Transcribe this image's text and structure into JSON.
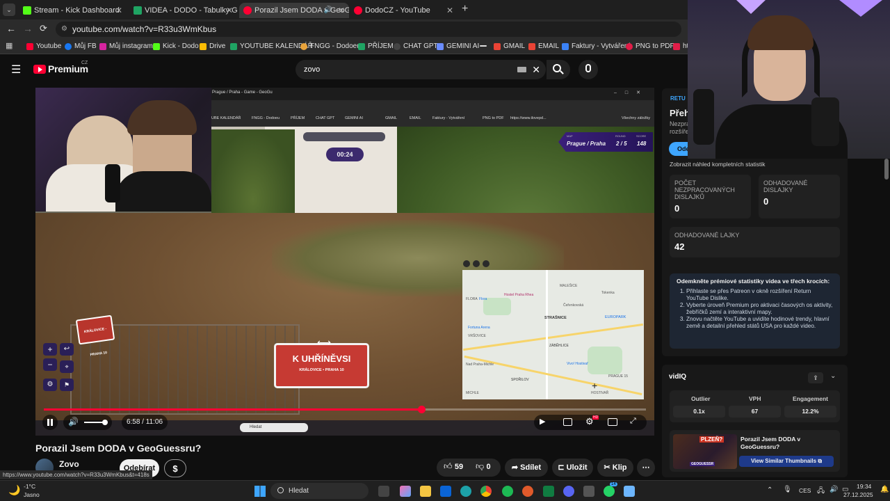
{
  "browser": {
    "tabs": [
      {
        "label": "Stream - Kick Dashboard",
        "color": "#53fc18"
      },
      {
        "label": "VIDEA - DODO - Tabulky Googl",
        "color": "#1fa463"
      },
      {
        "label": "Porazil Jsem DODA v GeoGu",
        "color": "#ff0033"
      },
      {
        "label": "DodoCZ - YouTube",
        "color": "#ff0033"
      }
    ],
    "address": "youtube.com/watch?v=R33u3WmKbus",
    "bookmarks": [
      "Youtube",
      "Můj FB",
      "Můj instagram",
      "Kick - Dodo",
      "Drive",
      "YOUTUBE KALENDÁŘ",
      "FNGG - Dodoeu",
      "PŘÍJEM",
      "CHAT GPT",
      "GEMINI AI",
      "GMAIL",
      "EMAIL",
      "Faktury - Vytváření",
      "PNG to PDF",
      "htt"
    ]
  },
  "youtube": {
    "logo": "Premium",
    "logo_region": "CZ",
    "search_value": "zovo"
  },
  "player": {
    "geo_timer": "00:24",
    "geo_map_label": "MAP",
    "geo_round_label": "ROUND",
    "geo_score_label": "SCORE",
    "geo_map": "Prague / Praha",
    "geo_round": "2 / 5",
    "geo_score": "148",
    "inner_tab": "Prague / Praha - Game - GeoGu",
    "inner_bookmarks": [
      "UBE KALENDÁŘ",
      "FNGG - Dodoeu",
      "PŘÍJEM",
      "CHAT GPT",
      "GEMINI AI",
      "GMAIL",
      "EMAIL",
      "Faktury - Vytváření",
      "PNG to PDF",
      "https://www.ilovepd...",
      "Všechny záložky"
    ],
    "sign_line1": "K UHŘÍNĚVSI",
    "sign_line2": "KRÁLOVICE • PRAHA 10",
    "sign_small": "KRÁLOVICE - PRAHA 10",
    "inner_taskbar_search": "Hledat",
    "map_labels": [
      "MALEŠICE",
      "Hostel Praha Rhea",
      "Tokenka",
      "FLORA",
      "Flora",
      "Čeřenkovská",
      "STRAŠNICE",
      "EUROPARK",
      "Fortuna Arena",
      "VRŠOVICE",
      "Nad Praha-Michle",
      "ZÁBĚHLICE",
      "Vivo! Hostivař",
      "SPOŘILOV",
      "PRAGUE 15",
      "HOSTIVAŘ",
      "MICHLE"
    ],
    "time_current": "6:58",
    "time_total": "11:06",
    "progress": 0.628
  },
  "video": {
    "title": "Porazil Jsem DODA v GeoGuessru?",
    "channel": "Zovo",
    "subscribe": "Odebírat",
    "likes": "59",
    "dislikes": "0",
    "share": "Sdílet",
    "save": "Uložit",
    "clip": "Klip",
    "status_url": "https://www.youtube.com/watch?v=R33u3WmKbus&t=418s"
  },
  "sidepanel": {
    "badge": "RETU",
    "heading": "Přeh",
    "sub1": "Nezpra",
    "sub2": "rozšíře",
    "button": "Ode",
    "stats_link": "Zobrazit náhled kompletních statistik",
    "stats": [
      {
        "label": "Počet nezpracovaných dislajků",
        "value": "0"
      },
      {
        "label": "Odhadované dislajky",
        "value": "0"
      },
      {
        "label": "Odhadované lajky",
        "value": "42"
      }
    ],
    "premium_title": "Odemkněte prémiové statistiky videa ve třech krocích:",
    "premium_steps": [
      "Přihlaste se přes Patreon v okně rozšíření Return YouTube Dislike.",
      "Vyberte úroveň Premium pro aktivaci časových os aktivity, žebříčků zemí a interaktivní mapy.",
      "Znovu načtěte YouTube a uvidíte hodinové trendy, hlavní země a detailní přehled států USA pro každé video."
    ],
    "vidiq_logo": "vidIQ",
    "metrics": [
      {
        "label": "Outlier",
        "value": "0.1x"
      },
      {
        "label": "VPH",
        "value": "67"
      },
      {
        "label": "Engagement",
        "value": "12.2%"
      }
    ],
    "thumb_title": "Porazil Jsem DODA v GeoGuessru?",
    "thumb_badge": "PLZEŇ?",
    "thumb_logo": "GEOGUESSR",
    "similar": "View Similar Thumbnails"
  },
  "taskbar": {
    "weather_temp": "-1°C",
    "weather_desc": "Jasno",
    "search": "Hledat",
    "lang": "CES",
    "time": "19:34",
    "date": "27.12.2025",
    "badge_count": "14"
  }
}
